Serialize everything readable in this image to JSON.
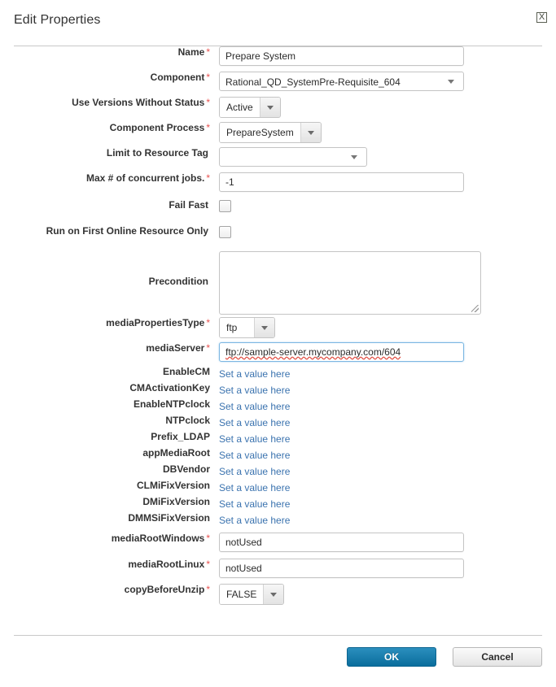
{
  "dialog": {
    "title": "Edit Properties",
    "close_icon": "close-x-icon",
    "close_label": "X"
  },
  "fields": {
    "name": {
      "label": "Name",
      "required": "*",
      "value": "Prepare System"
    },
    "component": {
      "label": "Component",
      "required": "*",
      "value": "Rational_QD_SystemPre-Requisite_604"
    },
    "use_versions_without_status": {
      "label": "Use Versions Without Status",
      "required": "*",
      "value": "Active"
    },
    "component_process": {
      "label": "Component Process",
      "required": "*",
      "value": "PrepareSystem"
    },
    "limit_to_resource_tag": {
      "label": "Limit to Resource Tag",
      "required": "",
      "value": ""
    },
    "max_concurrent_jobs": {
      "label": "Max # of concurrent jobs.",
      "required": "*",
      "value": "-1"
    },
    "fail_fast": {
      "label": "Fail Fast",
      "required": "",
      "checked": false
    },
    "run_on_first_online_resource_only": {
      "label": "Run on First Online Resource Only",
      "required": "",
      "checked": false
    },
    "precondition": {
      "label": "Precondition",
      "required": "",
      "value": ""
    },
    "media_properties_type": {
      "label": "mediaPropertiesType",
      "required": "*",
      "value": "ftp"
    },
    "media_server": {
      "label": "mediaServer",
      "required": "*",
      "value": "ftp://sample-server.mycompany.com/604"
    },
    "media_root_windows": {
      "label": "mediaRootWindows",
      "required": "*",
      "value": "notUsed"
    },
    "media_root_linux": {
      "label": "mediaRootLinux",
      "required": "*",
      "value": "notUsed"
    },
    "copy_before_unzip": {
      "label": "copyBeforeUnzip",
      "required": "*",
      "value": "FALSE"
    }
  },
  "unset_properties": {
    "link_label": "Set a value here",
    "items": [
      {
        "label": "EnableCM"
      },
      {
        "label": "CMActivationKey"
      },
      {
        "label": "EnableNTPclock"
      },
      {
        "label": "NTPclock"
      },
      {
        "label": "Prefix_LDAP"
      },
      {
        "label": "appMediaRoot"
      },
      {
        "label": "DBVendor"
      },
      {
        "label": "CLMiFixVersion"
      },
      {
        "label": "DMiFixVersion"
      },
      {
        "label": "DMMSiFixVersion"
      }
    ]
  },
  "footer": {
    "ok_label": "OK",
    "cancel_label": "Cancel"
  },
  "colors": {
    "required_asterisk": "#e8514f",
    "link": "#3b73af",
    "primary_button": "#0a6d9c",
    "focus_border": "#7cb7e2",
    "spellcheck_underline": "#e04a3f"
  }
}
